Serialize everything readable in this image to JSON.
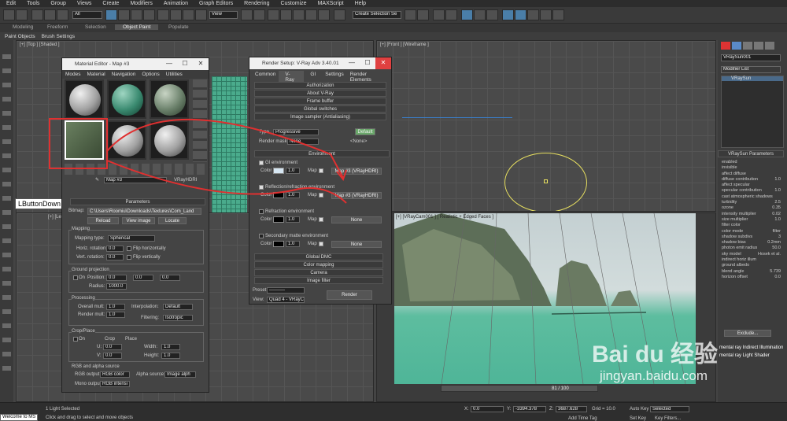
{
  "menu": [
    "Edit",
    "Tools",
    "Group",
    "Views",
    "Create",
    "Modifiers",
    "Animation",
    "Graph Editors",
    "Rendering",
    "Customize",
    "MAXScript",
    "Help"
  ],
  "toolbar": {
    "filter": "All",
    "view": "View",
    "selection_set": "Create Selection Se"
  },
  "ribbon": {
    "tabs": [
      "Modeling",
      "Freeform",
      "Selection",
      "Object Paint",
      "Populate"
    ],
    "sub": [
      "Paint Objects",
      "Brush Settings"
    ]
  },
  "viewports": {
    "top_left": "[+] [Top ] [Shaded ]",
    "top_right": "[+] [Front ] [Wireframe ]",
    "bottom_left": "[+] [Left ] [Wireframe ]",
    "camera": "[+] [VRayCam001 ] [ Realistic + Edged Faces ]"
  },
  "tooltip": "LButtonDown",
  "material_editor": {
    "title": "Material Editor - Map #3",
    "menu": [
      "Modes",
      "Material",
      "Navigation",
      "Options",
      "Utilities"
    ],
    "map_name": "Map #3",
    "map_type": "VRayHDRI",
    "rollout": "Parameters",
    "bitmap_label": "Bitmap:",
    "bitmap_path": "C:\\Users\\Roomiu\\Downloads\\Textures\\Com_Land",
    "reload": "Reload",
    "view_image": "View image",
    "locate": "Locate",
    "mapping": {
      "title": "Mapping",
      "type_label": "Mapping type:",
      "type": "Spherical",
      "horiz_label": "Horiz. rotation:",
      "horiz": "0.0",
      "flip_h": "Flip horizontally",
      "vert_label": "Vert. rotation:",
      "vert": "0.0",
      "flip_v": "Flip vertically"
    },
    "ground": {
      "title": "Ground projection",
      "on": "On",
      "position": "Position:",
      "x": "0.0",
      "y": "0.0",
      "z": "0.0",
      "radius_label": "Radius:",
      "radius": "1000.0"
    },
    "processing": {
      "title": "Processing",
      "overall_label": "Overall mult:",
      "overall": "1.0",
      "render_label": "Render mult:",
      "render": "1.0",
      "interp_label": "Interpolation:",
      "interp": "Default",
      "filter_label": "Filtering:",
      "filter": "Isotropic"
    },
    "crop": {
      "title": "Crop/Place",
      "on": "On",
      "crop": "Crop",
      "place": "Place",
      "u": "0.0",
      "v": "0.0",
      "w": "1.0",
      "h": "1.0",
      "u_l": "U:",
      "v_l": "V:",
      "w_l": "Width:",
      "h_l": "Height:"
    },
    "rgba": {
      "title": "RGB and alpha source",
      "rgb_label": "RGB output:",
      "rgb": "RGB color",
      "alpha_label": "Alpha source:",
      "alpha": "Image alph",
      "mono_label": "Mono output:",
      "mono": "RGB intensi"
    }
  },
  "render_setup": {
    "title": "Render Setup: V-Ray Adv 3.40.01",
    "tabs": [
      "Common",
      "V-Ray",
      "GI",
      "Settings",
      "Render Elements"
    ],
    "rollouts_top": [
      "Authorization",
      "About V-Ray",
      "Frame buffer",
      "Global switches"
    ],
    "sampler": "Image sampler (Antialiasing)",
    "type_label": "Type",
    "type": "Progressive",
    "default_btn": "Default",
    "mask_label": "Render mask",
    "mask": "None",
    "mask_btn": "<None>",
    "env_title": "Environment",
    "gi_env": "GI environment",
    "color_label": "Color",
    "mult": "1.0",
    "map_label": "Map",
    "map_btn": "Map #3 (VRayHDRI)",
    "refl_env": "Reflection/refraction environment",
    "refr_env": "Refraction environment",
    "none": "None",
    "matte_env": "Secondary matte environment",
    "rollouts_bottom": [
      "Global DMC",
      "Color mapping",
      "Camera",
      "Image filter"
    ],
    "preset_label": "Preset:",
    "preset": "----------",
    "view_label": "View:",
    "view": "Quad 4 - VRayC",
    "render_btn": "Render"
  },
  "command_panel": {
    "object_name": "VRaySun001",
    "modifier_list": "Modifier List",
    "stack_item": "VRaySun",
    "rollout": "VRaySun Parameters",
    "params": [
      [
        "enabled",
        ""
      ],
      [
        "invisible",
        ""
      ],
      [
        "affect diffuse",
        ""
      ],
      [
        "diffuse contribution",
        "1.0"
      ],
      [
        "affect specular",
        ""
      ],
      [
        "specular contribution",
        "1.0"
      ],
      [
        "cast atmospheric shadows",
        ""
      ],
      [
        "turbidity",
        "2.5"
      ],
      [
        "ozone",
        "0.35"
      ],
      [
        "intensity multiplier",
        "0.02"
      ],
      [
        "size multiplier",
        "1.0"
      ],
      [
        "filter color",
        ""
      ],
      [
        "color mode",
        "filter"
      ],
      [
        "shadow subdivs",
        "3"
      ],
      [
        "shadow bias",
        "0.2mm"
      ],
      [
        "photon emit radius",
        "50.0"
      ],
      [
        "sky model",
        "Hosek et al."
      ],
      [
        "indirect horiz illum",
        ""
      ],
      [
        "ground albedo",
        ""
      ],
      [
        "blend angle",
        "5.739"
      ],
      [
        "horizon offset",
        "0.0"
      ]
    ],
    "exclude": "Exclude...",
    "footer": [
      "mental ray Indirect Illumination",
      "mental ray Light Shader"
    ]
  },
  "status": {
    "left_field": "Welcome to MS",
    "selected": "1 Light Selected",
    "hint": "Click and drag to select and move objects",
    "x_label": "X:",
    "x": "0.0",
    "y_label": "Y:",
    "y": "-3394.378",
    "z_label": "Z:",
    "z": "3687.628",
    "grid": "Grid = 10.0",
    "add_time_tag": "Add Time Tag",
    "auto_key": "Auto Key",
    "set_key": "Set Key",
    "selected_dd": "Selected",
    "key_filters": "Key Filters...",
    "frame": "81 / 100"
  },
  "watermark": {
    "text": "Bai du 经验",
    "url": "jingyan.baidu.com"
  }
}
